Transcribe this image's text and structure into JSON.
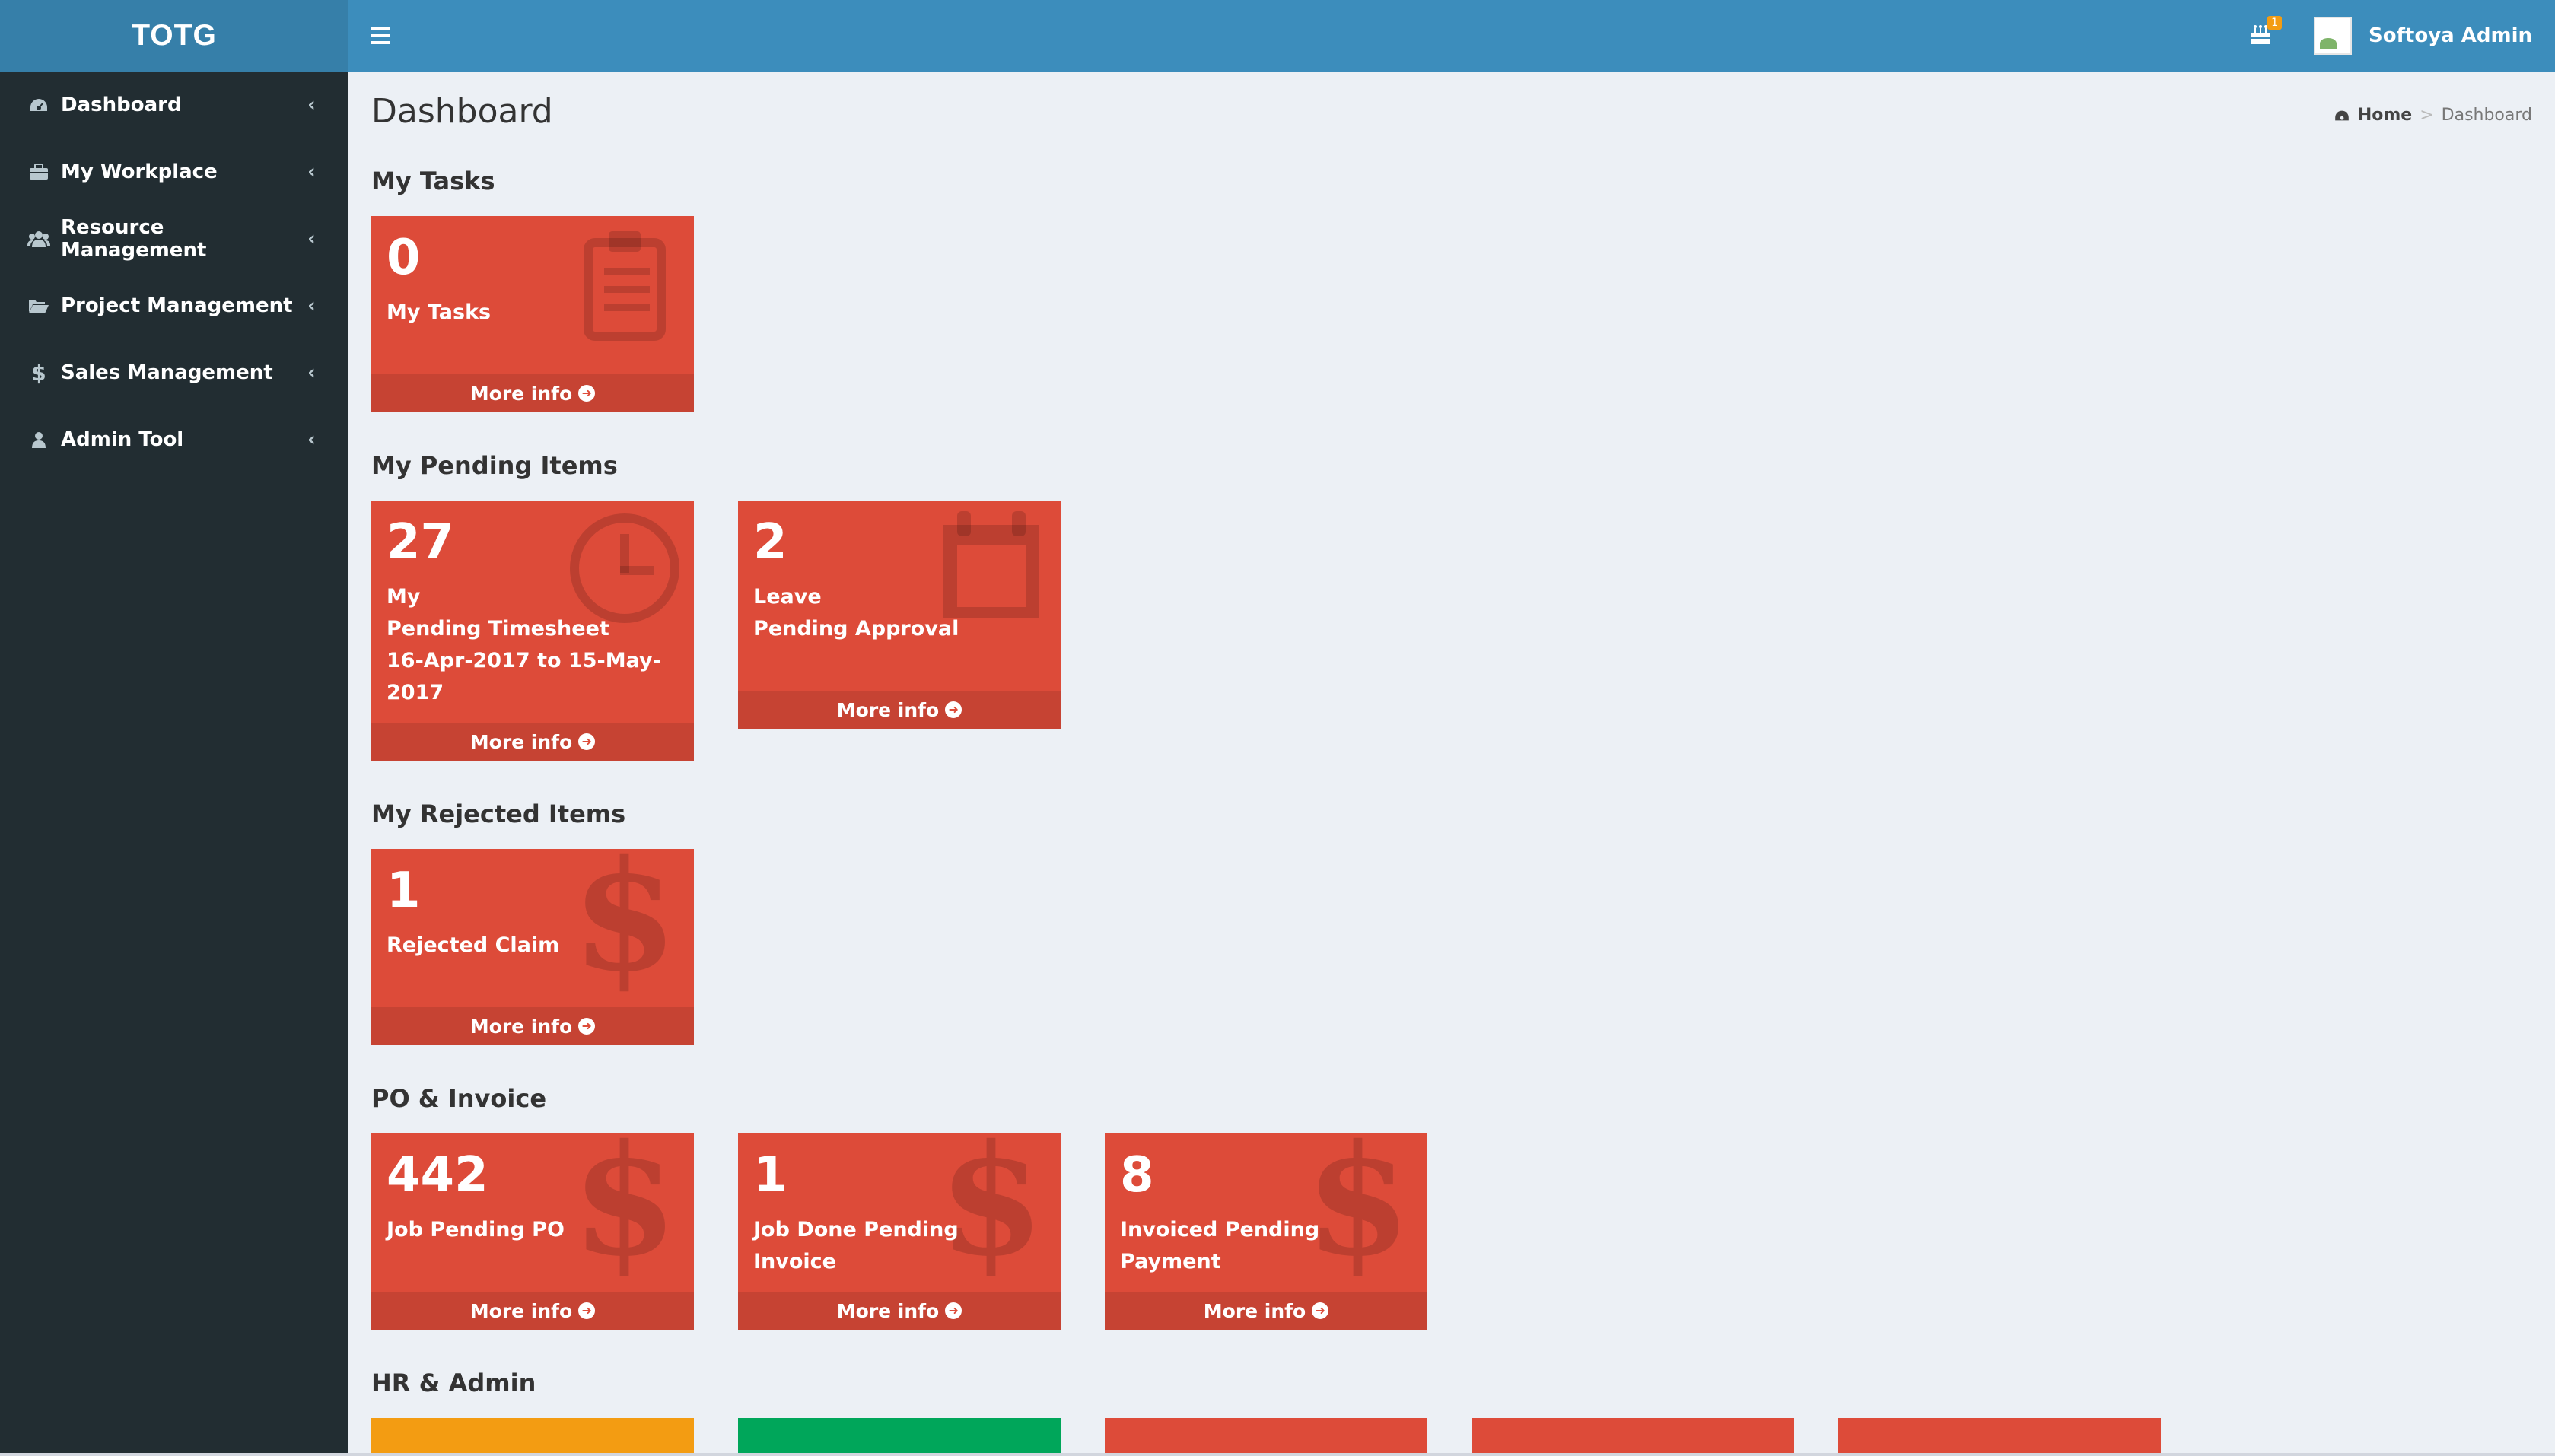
{
  "app": {
    "logo": "TOTG"
  },
  "sidebar": {
    "items": [
      {
        "label": "Dashboard",
        "icon": "dashboard-icon"
      },
      {
        "label": "My Workplace",
        "icon": "briefcase-icon"
      },
      {
        "label": "Resource Management",
        "icon": "users-icon"
      },
      {
        "label": "Project Management",
        "icon": "folder-open-icon"
      },
      {
        "label": "Sales Management",
        "icon": "dollar-icon"
      },
      {
        "label": "Admin Tool",
        "icon": "user-icon"
      }
    ]
  },
  "header": {
    "notification_count": "1",
    "user_name": "Softoya Admin"
  },
  "page": {
    "title": "Dashboard",
    "breadcrumb": {
      "home": "Home",
      "separator": ">",
      "current": "Dashboard"
    }
  },
  "sections": {
    "my_tasks": {
      "title": "My Tasks",
      "boxes": [
        {
          "value": "0",
          "label": "My Tasks",
          "more": "More info",
          "icon": "clipboard-icon"
        }
      ]
    },
    "pending": {
      "title": "My Pending Items",
      "boxes": [
        {
          "value": "27",
          "label_line1": "My",
          "label_line2": "Pending Timesheet",
          "label_line3": "16-Apr-2017 to 15-May-2017",
          "more": "More info",
          "icon": "clock-icon"
        },
        {
          "value": "2",
          "label_line1": "Leave",
          "label_line2": "Pending Approval",
          "more": "More info",
          "icon": "calendar-icon"
        }
      ]
    },
    "rejected": {
      "title": "My Rejected Items",
      "boxes": [
        {
          "value": "1",
          "label": "Rejected Claim",
          "more": "More info",
          "icon": "dollar-icon"
        }
      ]
    },
    "po_invoice": {
      "title": "PO & Invoice",
      "boxes": [
        {
          "value": "442",
          "label": "Job Pending PO",
          "more": "More info",
          "icon": "dollar-icon"
        },
        {
          "value": "1",
          "label": "Job Done Pending Invoice",
          "more": "More info",
          "icon": "dollar-icon"
        },
        {
          "value": "8",
          "label": "Invoiced Pending Payment",
          "more": "More info",
          "icon": "dollar-icon"
        }
      ]
    },
    "hr_admin": {
      "title": "HR & Admin"
    }
  },
  "colors": {
    "red": "#dd4b39",
    "yellow": "#f39c12",
    "green": "#00a65a",
    "header": "#3c8dbc",
    "sidebar": "#222d32"
  }
}
